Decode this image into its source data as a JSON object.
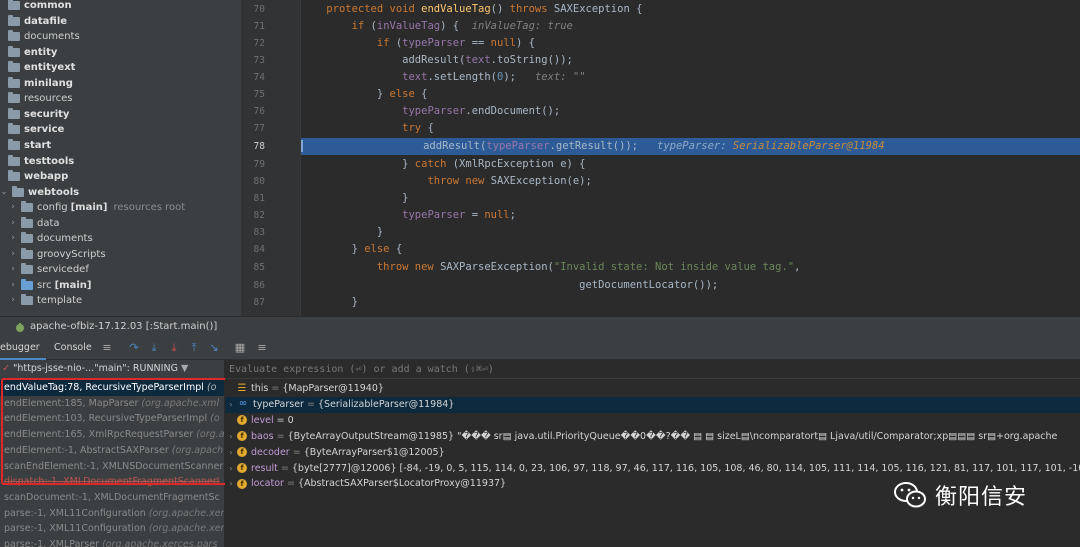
{
  "project_tree": {
    "items": [
      {
        "label": "common",
        "bold": true,
        "indent": 0
      },
      {
        "label": "datafile",
        "bold": true,
        "indent": 0
      },
      {
        "label": "documents",
        "bold": false,
        "indent": 0
      },
      {
        "label": "entity",
        "bold": true,
        "indent": 0
      },
      {
        "label": "entityext",
        "bold": true,
        "indent": 0
      },
      {
        "label": "minilang",
        "bold": true,
        "indent": 0
      },
      {
        "label": "resources",
        "bold": false,
        "indent": 0
      },
      {
        "label": "security",
        "bold": true,
        "indent": 0
      },
      {
        "label": "service",
        "bold": true,
        "indent": 0
      },
      {
        "label": "start",
        "bold": true,
        "indent": 0
      },
      {
        "label": "testtools",
        "bold": true,
        "indent": 0
      },
      {
        "label": "webapp",
        "bold": true,
        "indent": 0
      },
      {
        "label": "webtools",
        "bold": true,
        "indent": 0,
        "expanded": true
      },
      {
        "label": "config",
        "tag": "[main]",
        "sub": "resources root",
        "bold": false,
        "indent": 1
      },
      {
        "label": "data",
        "bold": false,
        "indent": 1
      },
      {
        "label": "documents",
        "bold": false,
        "indent": 1
      },
      {
        "label": "groovyScripts",
        "bold": false,
        "indent": 1
      },
      {
        "label": "servicedef",
        "bold": false,
        "indent": 1
      },
      {
        "label": "src",
        "tag": "[main]",
        "bold": false,
        "indent": 1,
        "blue": true
      },
      {
        "label": "template",
        "bold": false,
        "indent": 1
      }
    ]
  },
  "editor": {
    "line_numbers": [
      "70",
      "71",
      "72",
      "73",
      "74",
      "75",
      "76",
      "77",
      "78",
      "79",
      "80",
      "81",
      "82",
      "83",
      "84",
      "85",
      "86",
      "87"
    ],
    "current_line": "78",
    "hints": {
      "in_value_tag": "inValueTag: true",
      "text_hint": "text: \"\"",
      "type_parser_hint_name": "typeParser:",
      "type_parser_hint_value": "SerializableParser@11984"
    }
  },
  "debugger": {
    "run_config": "apache-ofbiz-17.12.03 [:Start.main()]",
    "tabs": {
      "debugger": "ebugger",
      "console": "Console"
    },
    "thread_selector": "\"https-jsse-nio-...\"main\": RUNNING",
    "eval_placeholder": "Evaluate expression (⏎) or add a watch (⇧⌘⏎)",
    "frames": [
      {
        "method": "endValueTag:78, RecursiveTypeParserImpl",
        "pkg": "(o",
        "selected": true
      },
      {
        "method": "endElement:185, MapParser",
        "pkg": "(org.apache.xml"
      },
      {
        "method": "endElement:103, RecursiveTypeParserImpl",
        "pkg": "(o"
      },
      {
        "method": "endElement:165, XmlRpcRequestParser",
        "pkg": "(org.a"
      },
      {
        "method": "endElement:-1, AbstractSAXParser",
        "pkg": "(org.apach"
      },
      {
        "method": "scanEndElement:-1, XMLNSDocumentScanner",
        "pkg": ""
      },
      {
        "method": "dispatch:-1, XMLDocumentFragmentScannerI",
        "pkg": "",
        "strike": true
      },
      {
        "method": "scanDocument:-1, XMLDocumentFragmentSc",
        "pkg": ""
      },
      {
        "method": "parse:-1, XML11Configuration",
        "pkg": "(org.apache.xer"
      },
      {
        "method": "parse:-1, XML11Configuration",
        "pkg": "(org.apache.xer"
      },
      {
        "method": "parse:-1, XMLParser",
        "pkg": "(org.apache.xerces.pars"
      }
    ],
    "variables": [
      {
        "icon": "bars",
        "name": "this",
        "value": "{MapParser@11940}"
      },
      {
        "icon": "oo",
        "name": "typeParser",
        "value": "{SerializableParser@11984}",
        "selected": true,
        "expandable": true
      },
      {
        "icon": "f",
        "name": "level",
        "value": "= 0"
      },
      {
        "icon": "f",
        "name": "baos",
        "value": "{ByteArrayOutputStream@11985} \"��� sr▤ java.util.PriorityQueue��0��?�� ▤ ▤ sizeL▤\\ncomparatort▤ Ljava/util/Comparator;xp▤▤▤ sr▤+org.apache",
        "expandable": true
      },
      {
        "icon": "f",
        "name": "decoder",
        "value": "{ByteArrayParser$1@12005}",
        "expandable": true
      },
      {
        "icon": "f",
        "name": "result",
        "value": "{byte[2777]@12006} [-84, -19, 0, 5, 115, 114, 0, 23, 106, 97, 118, 97, 46, 117, 116, 105, 108, 46, 80, 114, 105, 111, 114, 105, 116, 121, 81, 117, 101, 117, 101, -108, -38, 48, -",
        "expandable": true
      },
      {
        "icon": "f",
        "name": "locator",
        "value": "{AbstractSAXParser$LocatorProxy@11937}",
        "expandable": true
      }
    ]
  },
  "watermark": {
    "text": "衡阳信安",
    "color": "#ffffff"
  },
  "colors": {
    "highlight": "#e02828",
    "exec_line": "#2d5b97",
    "accent": "#4a88c7"
  }
}
